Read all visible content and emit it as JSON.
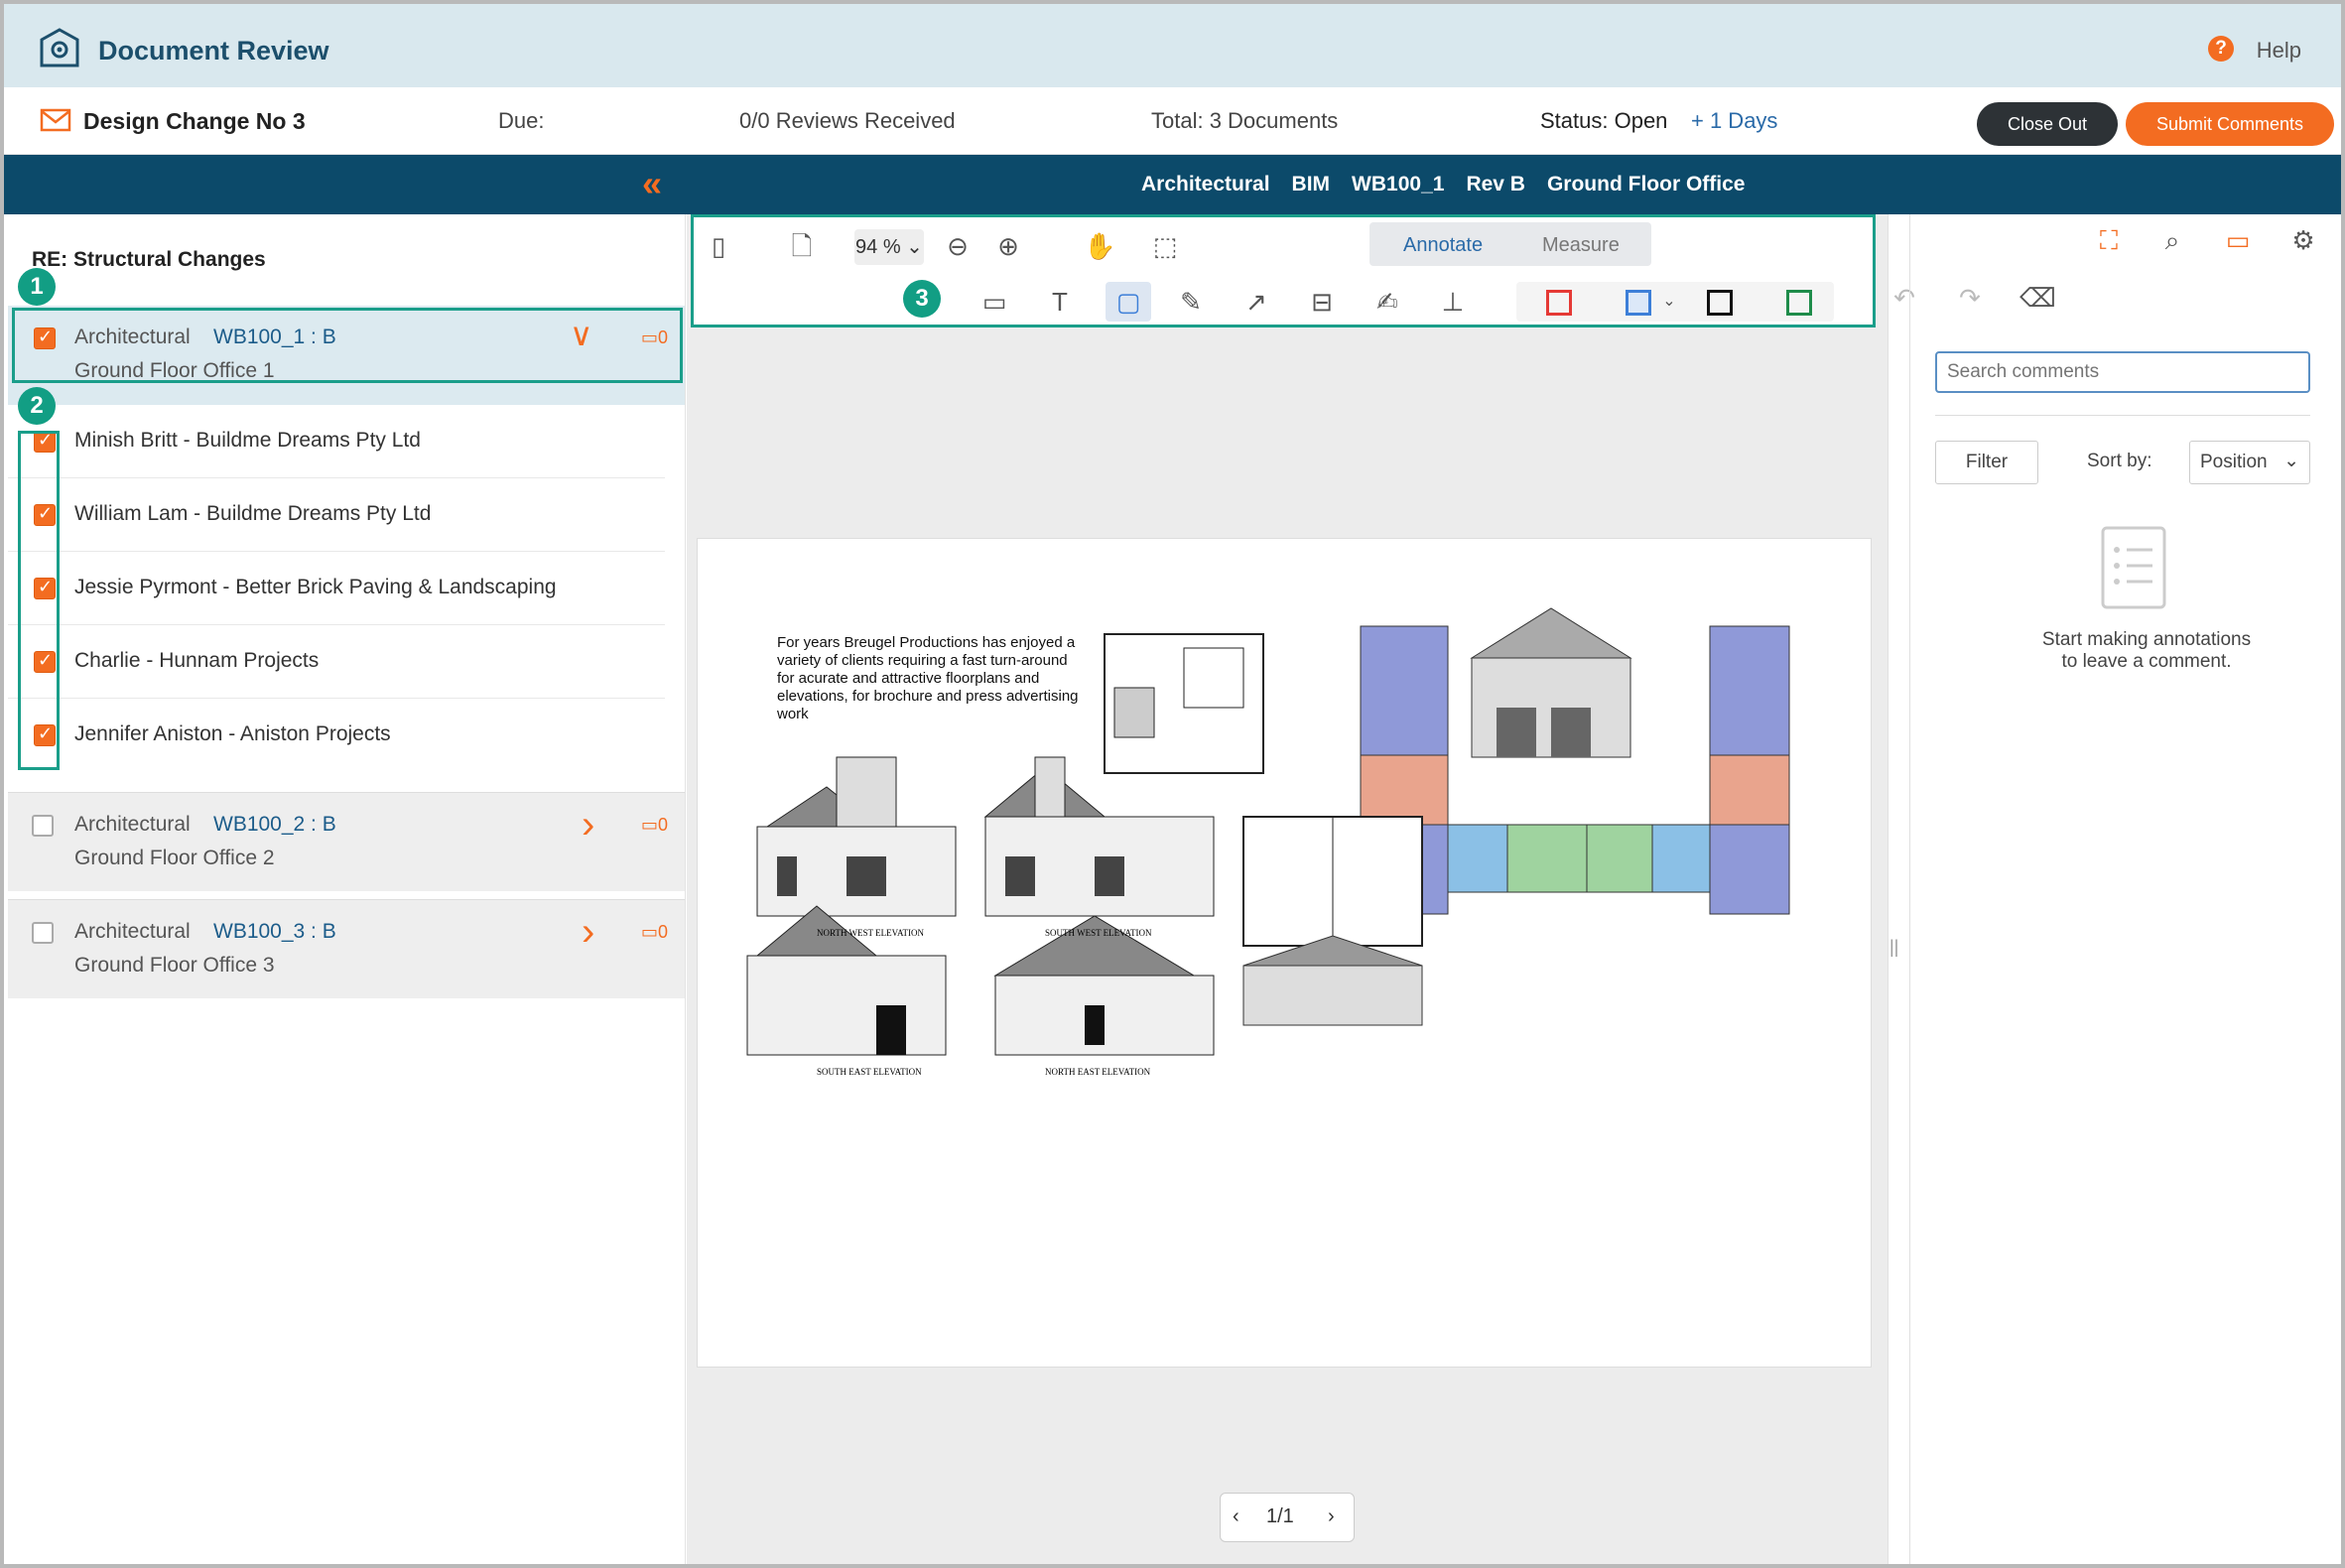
{
  "header": {
    "app_title": "Document Review",
    "help_label": "Help",
    "help_icon_glyph": "?"
  },
  "info": {
    "title": "Design Change No 3",
    "due": "Due:",
    "reviews": "0/0 Reviews Received",
    "total": "Total: 3 Documents",
    "status": "Status: Open",
    "days": "+ 1 Days",
    "close_label": "Close Out",
    "submit_label": "Submit Comments"
  },
  "breadcrumb": {
    "collapse_glyph": "«",
    "items": [
      "Architectural",
      "BIM",
      "WB100_1",
      "Rev B",
      "Ground Floor Office"
    ]
  },
  "left": {
    "title": "RE: Structural Changes",
    "docs": [
      {
        "category": "Architectural",
        "code": "WB100_1 : B",
        "location": "Ground Floor Office 1",
        "comments": "0",
        "chevron": "∨"
      },
      {
        "category": "Architectural",
        "code": "WB100_2 : B",
        "location": "Ground Floor Office 2",
        "comments": "0",
        "chevron": "›"
      },
      {
        "category": "Architectural",
        "code": "WB100_3 : B",
        "location": "Ground Floor Office 3",
        "comments": "0",
        "chevron": "›"
      }
    ],
    "reviewers": [
      "Minish Britt - Buildme Dreams Pty Ltd",
      "William Lam - Buildme Dreams Pty Ltd",
      "Jessie Pyrmont - Better Brick Paving & Landscaping",
      "Charlie - Hunnam Projects",
      "Jennifer Aniston - Aniston Projects"
    ],
    "callouts": [
      "1",
      "2",
      "3"
    ]
  },
  "toolbar": {
    "zoom": "94 %",
    "tab_annotate": "Annotate",
    "tab_measure": "Measure",
    "colors": [
      "#e53935",
      "#3d7fd8",
      "#111111",
      "#1e8c4a"
    ]
  },
  "page": {
    "text": "For years Breugel Productions has enjoyed a variety of clients requiring a fast turn-around for acurate and attractive floorplans and elevations, for brochure and press advertising work",
    "elevation_labels": [
      "NORTH WEST ELEVATION",
      "SOUTH WEST ELEVATION",
      "SOUTH EAST ELEVATION",
      "NORTH EAST ELEVATION"
    ],
    "pager": "1/1"
  },
  "right": {
    "search_placeholder": "Search comments",
    "filter_label": "Filter",
    "sort_label": "Sort by:",
    "sort_value": "Position",
    "empty_line1": "Start making annotations",
    "empty_line2": "to leave a comment."
  }
}
